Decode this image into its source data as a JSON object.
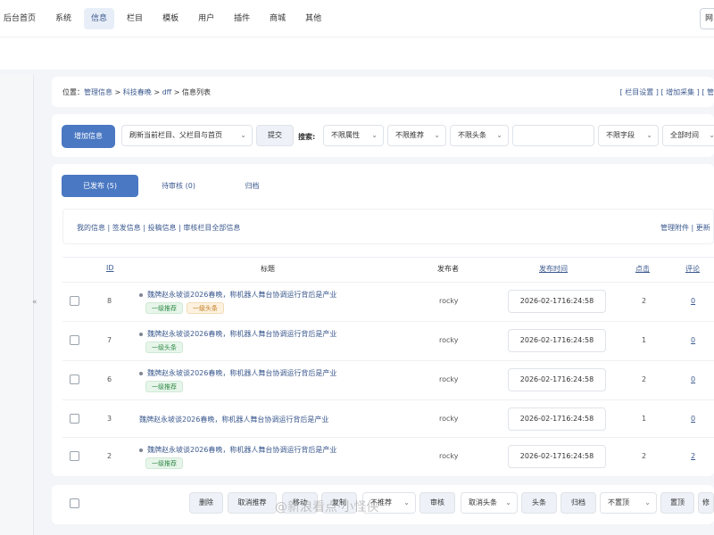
{
  "topnav": {
    "items": [
      "后台首页",
      "系统",
      "信息",
      "栏目",
      "模板",
      "用户",
      "插件",
      "商城",
      "其他"
    ],
    "active_index": 2,
    "user_box_text": "网"
  },
  "breadcrumb": {
    "prefix": "位置：",
    "parts": [
      "管理信息",
      "科技春晚",
      "dff",
      "信息列表"
    ],
    "separator": " > "
  },
  "top_links": {
    "items": [
      "[ 栏目设置 ]",
      "[ 增加采集 ]",
      "[ 管"
    ]
  },
  "toolbar": {
    "add_button": "增加信息",
    "refresh_select": "刷新当前栏目、父栏目与首页",
    "submit_button": "提交",
    "search_label": "搜索:",
    "attr_select": "不限属性",
    "recommend_select": "不限推荐",
    "headline_select": "不限头条",
    "search_input_value": "",
    "field_select": "不限字段",
    "time_select": "全部时间"
  },
  "tabs": [
    {
      "label": "已发布 (5)",
      "active": true
    },
    {
      "label": "待审核 (0)",
      "active": false
    },
    {
      "label": "归档",
      "active": false
    }
  ],
  "filter_links": "我的信息 | 签发信息 | 投稿信息 | 审核栏目全部信息",
  "manage_links": "管理附件 | 更新",
  "table": {
    "headers": {
      "id": "ID",
      "title": "标题",
      "publisher": "发布者",
      "pubtime": "发布时间",
      "clicks": "点击",
      "comments": "评论"
    },
    "rows": [
      {
        "id": "8",
        "title": "魏牌赵永坡谈2026春晚，称机器人舞台协调运行背后是产业",
        "badges": [
          {
            "text": "一级推荐",
            "color": "green"
          },
          {
            "text": "一级头条",
            "color": "orange"
          }
        ],
        "publisher": "rocky",
        "pubtime": "2026-02-1716:24:58",
        "clicks": "2",
        "comments": "0",
        "has_dot": true
      },
      {
        "id": "7",
        "title": "魏牌赵永坡谈2026春晚，称机器人舞台协调运行背后是产业",
        "badges": [
          {
            "text": "一级头条",
            "color": "green"
          }
        ],
        "publisher": "rocky",
        "pubtime": "2026-02-1716:24:58",
        "clicks": "1",
        "comments": "0",
        "has_dot": true
      },
      {
        "id": "6",
        "title": "魏牌赵永坡谈2026春晚，称机器人舞台协调运行背后是产业",
        "badges": [
          {
            "text": "一级推荐",
            "color": "green"
          }
        ],
        "publisher": "rocky",
        "pubtime": "2026-02-1716:24:58",
        "clicks": "2",
        "comments": "0",
        "has_dot": true
      },
      {
        "id": "3",
        "title": "魏牌赵永坡谈2026春晚，称机器人舞台协调运行背后是产业",
        "badges": [],
        "publisher": "rocky",
        "pubtime": "2026-02-1716:24:58",
        "clicks": "1",
        "comments": "0",
        "has_dot": false
      },
      {
        "id": "2",
        "title": "魏牌赵永坡谈2026春晚，称机器人舞台协调运行背后是产业",
        "badges": [
          {
            "text": "一级推荐",
            "color": "green"
          }
        ],
        "publisher": "rocky",
        "pubtime": "2026-02-1716:24:58",
        "clicks": "2",
        "comments": "2",
        "has_dot": true
      }
    ]
  },
  "bottom_bar": {
    "delete": "删除",
    "cancel_recommend": "取消推荐",
    "btn3": "移动",
    "btn4": "复制",
    "recommend_select": "不推荐",
    "btn_audit": "审核",
    "headline_select": "取消头条",
    "headline_btn": "头条",
    "archive_btn": "归档",
    "top_select": "不置顶",
    "top_btn": "置顶",
    "edge_btn": "修"
  },
  "watermark": "@新浪看点·小怪侠",
  "collapse_icon_text": "«"
}
